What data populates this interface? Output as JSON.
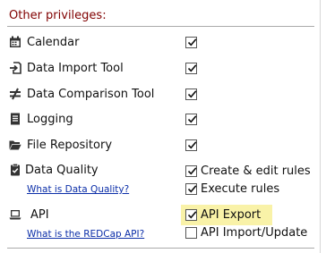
{
  "section_title": "Other privileges:",
  "rows": [
    {
      "label": "Calendar",
      "icon": "calendar-icon",
      "checked": true
    },
    {
      "label": "Data Import Tool",
      "icon": "import-icon",
      "checked": true
    },
    {
      "label": "Data Comparison Tool",
      "icon": "not-equal-icon",
      "checked": true
    },
    {
      "label": "Logging",
      "icon": "document-icon",
      "checked": true
    },
    {
      "label": "File Repository",
      "icon": "folder-open-icon",
      "checked": true
    }
  ],
  "data_quality": {
    "label": "Data Quality",
    "icon": "clipboard-check-icon",
    "help_link": "What is Data Quality?",
    "options": [
      {
        "label": "Create & edit rules",
        "checked": true
      },
      {
        "label": "Execute rules",
        "checked": true
      }
    ]
  },
  "api": {
    "label": "API",
    "icon": "laptop-icon",
    "help_link": "What is the REDCap API?",
    "options": [
      {
        "label": "API Export",
        "checked": true,
        "highlighted": true
      },
      {
        "label": "API Import/Update",
        "checked": false
      }
    ]
  },
  "colors": {
    "section_title": "#800000",
    "link": "#0b2ea8",
    "highlight": "#f9f2a8"
  }
}
